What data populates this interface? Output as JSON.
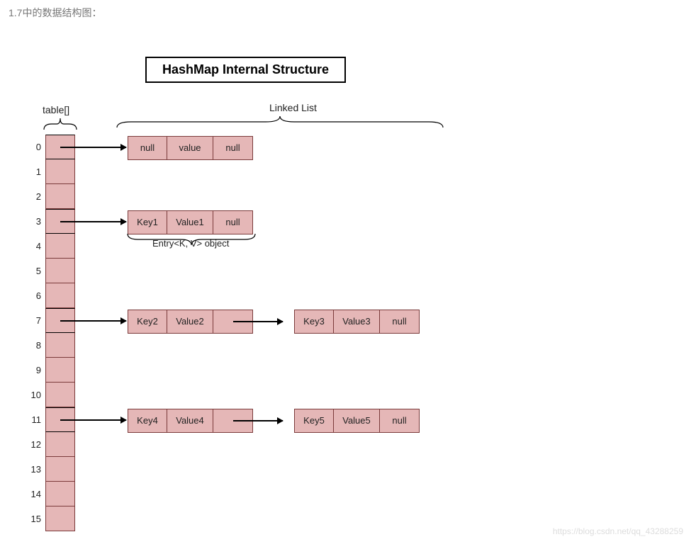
{
  "caption": "1.7中的数据结构图：",
  "title": "HashMap Internal Structure",
  "table_label": "table[]",
  "linked_list_label": "Linked List",
  "entry_label": "Entry<K, V> object",
  "table_size": 16,
  "rows_with_entries": [
    0,
    3,
    7,
    11
  ],
  "chains": {
    "0": [
      {
        "key": "null",
        "value": "value",
        "next": "null"
      }
    ],
    "3": [
      {
        "key": "Key1",
        "value": "Value1",
        "next": "null"
      }
    ],
    "7": [
      {
        "key": "Key2",
        "value": "Value2",
        "next": ""
      },
      {
        "key": "Key3",
        "value": "Value3",
        "next": "null"
      }
    ],
    "11": [
      {
        "key": "Key4",
        "value": "Value4",
        "next": ""
      },
      {
        "key": "Key5",
        "value": "Value5",
        "next": "null"
      }
    ]
  },
  "watermark": "https://blog.csdn.net/qq_43288259"
}
